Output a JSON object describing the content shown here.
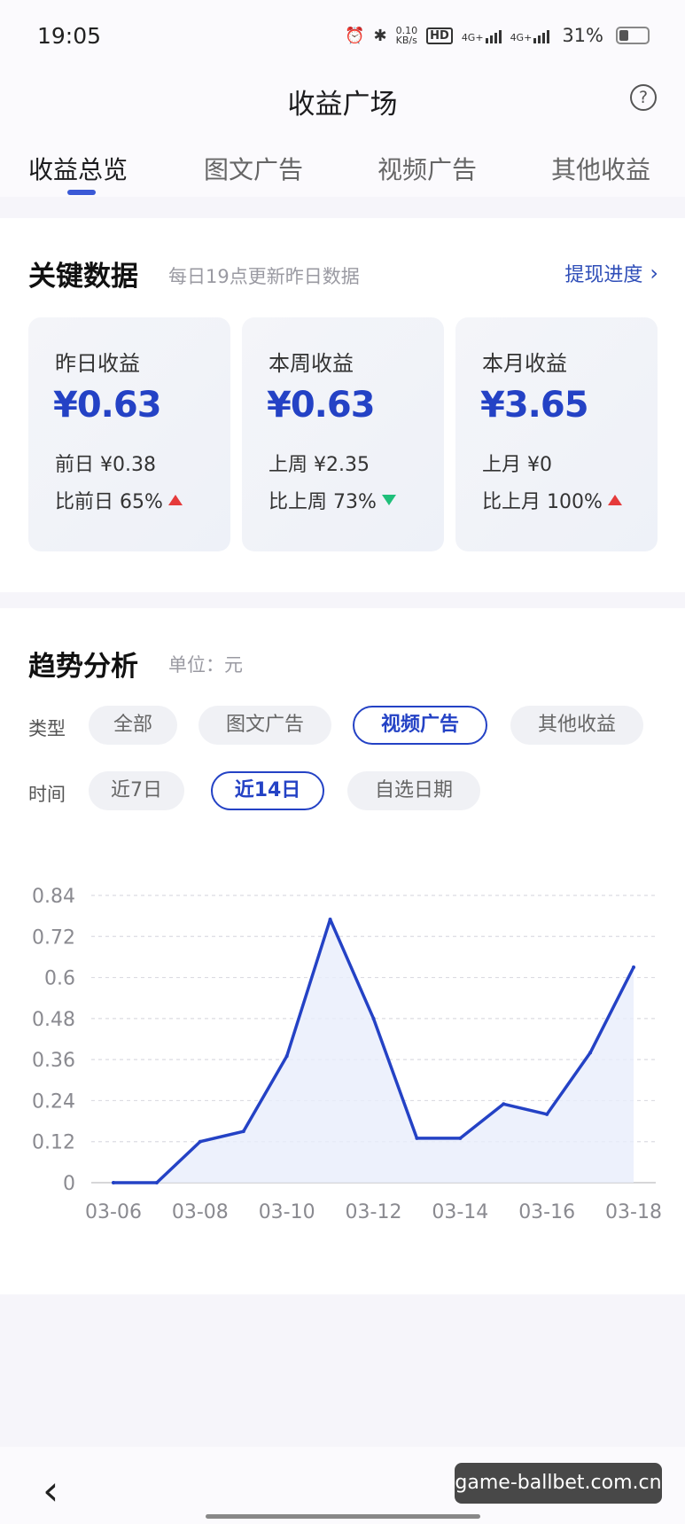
{
  "status": {
    "time": "19:05",
    "speed": "0.10",
    "speed_unit": "KB/s",
    "hd": "HD",
    "net1": "4G+",
    "net2": "4G+",
    "battery": "31%"
  },
  "header": {
    "title": "收益广场",
    "help": "?"
  },
  "tabs": [
    {
      "label": "收益总览",
      "active": true
    },
    {
      "label": "图文广告",
      "active": false
    },
    {
      "label": "视频广告",
      "active": false
    },
    {
      "label": "其他收益",
      "active": false
    }
  ],
  "key_data": {
    "title": "关键数据",
    "subtitle": "每日19点更新昨日数据",
    "withdraw_label": "提现进度",
    "stats": [
      {
        "label": "昨日收益",
        "value": "¥0.63",
        "prev": "前日 ¥0.38",
        "compare": "比前日 65%",
        "trend": "up"
      },
      {
        "label": "本周收益",
        "value": "¥0.63",
        "prev": "上周 ¥2.35",
        "compare": "比上周 73%",
        "trend": "down"
      },
      {
        "label": "本月收益",
        "value": "¥3.65",
        "prev": "上月 ¥0",
        "compare": "比上月 100%",
        "trend": "up"
      }
    ]
  },
  "trend": {
    "title": "趋势分析",
    "unit": "单位：元",
    "type_label": "类型",
    "type_options": [
      "全部",
      "图文广告",
      "视频广告",
      "其他收益"
    ],
    "type_selected": "视频广告",
    "time_label": "时间",
    "time_options": [
      "近7日",
      "近14日",
      "自选日期"
    ],
    "time_selected": "近14日"
  },
  "colors": {
    "accent": "#2442c5",
    "up": "#e53b3b",
    "down": "#1fbf7a",
    "area": "#e8edfb"
  },
  "chart_data": {
    "type": "area",
    "x": [
      "03-06",
      "03-07",
      "03-08",
      "03-09",
      "03-10",
      "03-11",
      "03-12",
      "03-13",
      "03-14",
      "03-15",
      "03-16",
      "03-17",
      "03-18"
    ],
    "x_tick_labels": [
      "03-06",
      "03-08",
      "03-10",
      "03-12",
      "03-14",
      "03-16",
      "03-18"
    ],
    "values": [
      0,
      0,
      0.12,
      0.15,
      0.37,
      0.77,
      0.48,
      0.13,
      0.13,
      0.23,
      0.2,
      0.38,
      0.63
    ],
    "y_ticks": [
      "0",
      "0.12",
      "0.24",
      "0.36",
      "0.48",
      "0.6",
      "0.72",
      "0.84"
    ],
    "ylim": [
      0,
      0.84
    ],
    "grid": true,
    "legend": "none"
  },
  "nav": {
    "back": "‹",
    "watermark": "game-ballbet.com.cn"
  }
}
